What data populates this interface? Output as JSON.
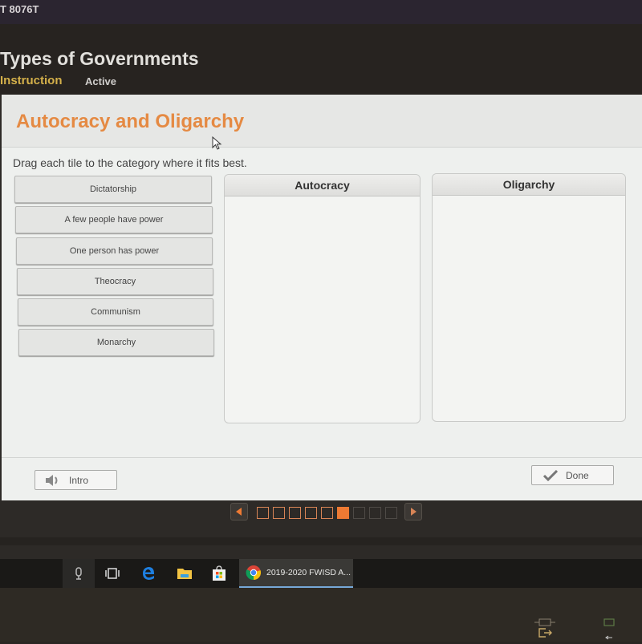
{
  "course_code": "T 8076T",
  "lesson": {
    "title": "Types of Governments",
    "tabs": [
      {
        "label": "Instruction",
        "active": true
      },
      {
        "label": "Active",
        "active": false
      }
    ]
  },
  "activity": {
    "title": "Autocracy and Oligarchy",
    "instructions": "Drag each tile to the category where it fits best.",
    "tiles": [
      "Dictatorship",
      "A few people have power",
      "One person has power",
      "Theocracy",
      "Communism",
      "Monarchy"
    ],
    "categories": [
      {
        "label": "Autocracy",
        "items": []
      },
      {
        "label": "Oligarchy",
        "items": []
      }
    ]
  },
  "buttons": {
    "intro": "Intro",
    "done": "Done"
  },
  "pagination": {
    "total": 9,
    "current": 6,
    "completed": 5
  },
  "taskbar": {
    "active_app": "2019-2020 FWISD A..."
  },
  "colors": {
    "accent": "#e58a43",
    "tab_active": "#d4b04a",
    "pager_current": "#ee7a33"
  }
}
